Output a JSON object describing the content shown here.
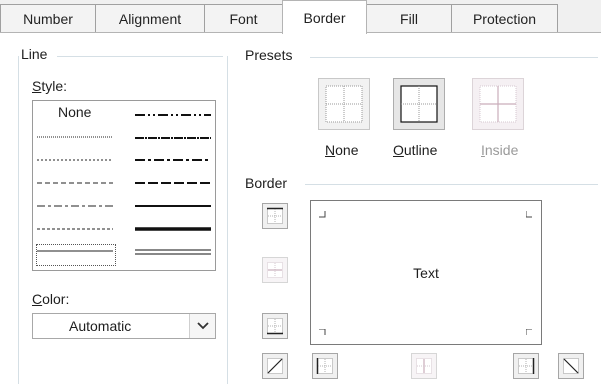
{
  "tabs": [
    "Number",
    "Alignment",
    "Font",
    "Border",
    "Fill",
    "Protection"
  ],
  "line": {
    "group_label": "Line",
    "style_label": "Style:",
    "none_label": "None",
    "color_label": "Color:",
    "color_value": "Automatic"
  },
  "presets": {
    "group_label": "Presets",
    "items": [
      {
        "label": "None",
        "icon": "preset-none-icon",
        "enabled": true
      },
      {
        "label": "Outline",
        "icon": "preset-outline-icon",
        "enabled": true
      },
      {
        "label": "Inside",
        "icon": "preset-inside-icon",
        "enabled": false
      }
    ]
  },
  "border": {
    "group_label": "Border",
    "preview_text": "Text"
  },
  "colors": {
    "dialog_bg": "#ffffff",
    "tab_strip_bg": "#f0f0f0",
    "disabled_text": "#9a9a9a",
    "separator": "#d5dfe5"
  }
}
